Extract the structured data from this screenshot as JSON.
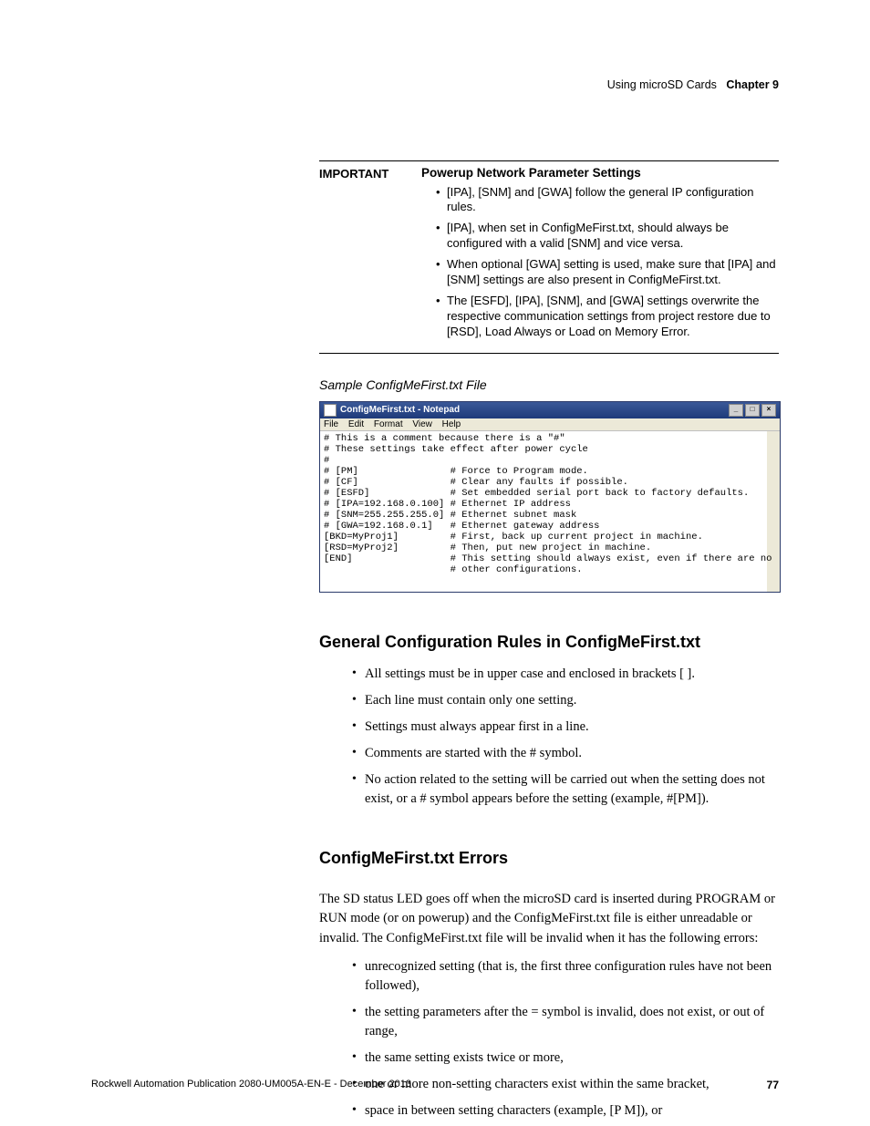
{
  "header": {
    "section_text": "Using microSD Cards",
    "chapter_label": "Chapter 9"
  },
  "important": {
    "label": "IMPORTANT",
    "heading": "Powerup Network Parameter Settings",
    "items": [
      "[IPA], [SNM] and [GWA] follow the general IP configuration rules.",
      "[IPA], when set in ConfigMeFirst.txt, should always be configured with a valid [SNM] and vice versa.",
      "When optional [GWA] setting is used, make sure that [IPA] and [SNM] settings are also present in ConfigMeFirst.txt.",
      "The [ESFD], [IPA], [SNM], and [GWA] settings overwrite the respective communication settings from project restore due to [RSD], Load Always or Load on Memory Error."
    ]
  },
  "sample_caption": "Sample ConfigMeFirst.txt File",
  "notepad": {
    "title": "ConfigMeFirst.txt - Notepad",
    "menu": [
      "File",
      "Edit",
      "Format",
      "View",
      "Help"
    ],
    "content": "# This is a comment because there is a \"#\"\n# These settings take effect after power cycle\n#\n# [PM]                # Force to Program mode.\n# [CF]                # Clear any faults if possible.\n# [ESFD]              # Set embedded serial port back to factory defaults.\n# [IPA=192.168.0.100] # Ethernet IP address\n# [SNM=255.255.255.0] # Ethernet subnet mask\n# [GWA=192.168.0.1]   # Ethernet gateway address\n[BKD=MyProj1]         # First, back up current project in machine.\n[RSD=MyProj2]         # Then, put new project in machine.\n[END]                 # This setting should always exist, even if there are no\n                      # other configurations."
  },
  "section1": {
    "heading": "General Configuration Rules in ConfigMeFirst.txt",
    "items": [
      "All settings must be in upper case and enclosed in brackets [ ].",
      "Each line must contain only one setting.",
      "Settings must always appear first in a line.",
      "Comments are started with the # symbol.",
      "No action related to the setting will be carried out when the setting does not exist, or a # symbol appears before the setting (example, #[PM])."
    ]
  },
  "section2": {
    "heading": "ConfigMeFirst.txt Errors",
    "para": "The SD status LED goes off when the microSD card is inserted during PROGRAM or RUN mode (or on powerup) and the ConfigMeFirst.txt file is either unreadable or invalid. The ConfigMeFirst.txt file will be invalid when it has the following errors:",
    "items": [
      "unrecognized setting (that is, the first three configuration rules have not been followed),",
      "the setting parameters after the = symbol is invalid, does not exist, or out of range,",
      "the same setting exists twice or more,",
      "one or more non-setting characters exist within the same bracket,",
      "space in between setting characters (example, [P M]), or"
    ]
  },
  "footer": {
    "pub": "Rockwell Automation Publication 2080-UM005A-EN-E - December 2013",
    "page": "77"
  }
}
